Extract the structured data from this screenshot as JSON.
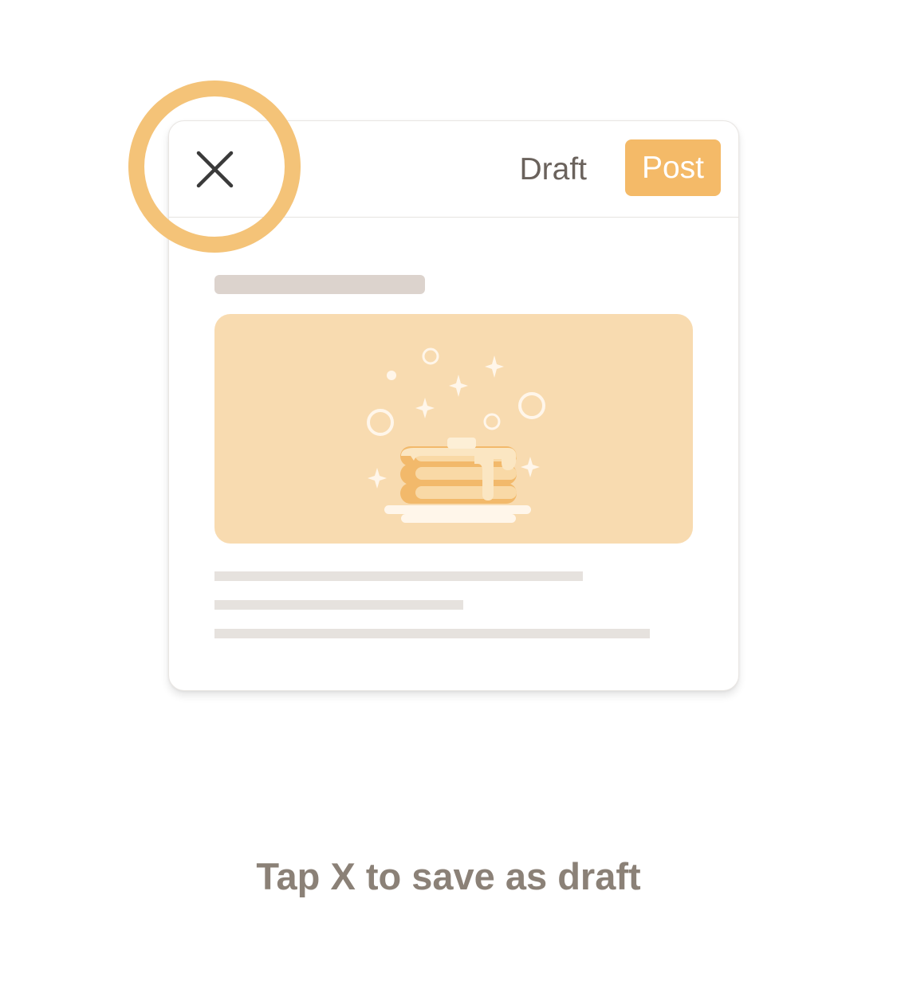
{
  "header": {
    "draft_label": "Draft",
    "post_label": "Post"
  },
  "icons": {
    "close": "close-icon",
    "illustration": "pancake-stack-icon"
  },
  "colors": {
    "accent": "#f4ba68",
    "highlight_ring": "#f4c378",
    "image_background": "#f8dbb0",
    "caption_text": "#8b8177",
    "draft_text": "#6a625c"
  },
  "caption": "Tap X to save as draft"
}
